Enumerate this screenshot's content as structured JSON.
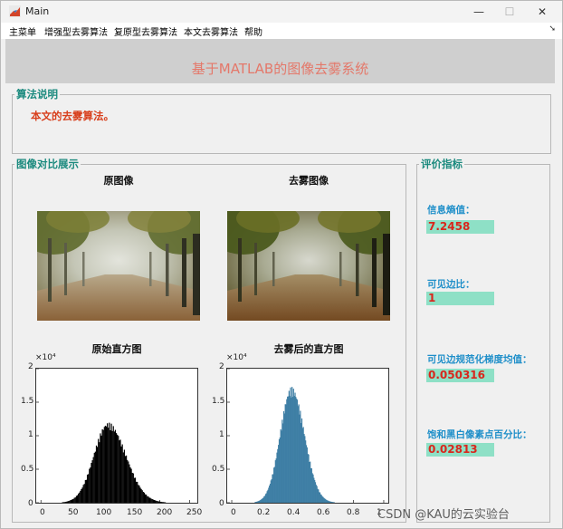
{
  "window": {
    "title": "Main",
    "minimize_glyph": "—",
    "maximize_glyph": "☐",
    "close_glyph": "✕"
  },
  "menu": {
    "items": [
      "主菜单",
      "增强型去雾算法",
      "复原型去雾算法",
      "本文去雾算法",
      "帮助"
    ],
    "overflow_arrow": "➘"
  },
  "banner": {
    "title": "基于MATLAB的图像去雾系统"
  },
  "algorithm_panel": {
    "title": "算法说明",
    "text": "本文的去雾算法。"
  },
  "comparison_panel": {
    "title": "图像对比展示",
    "original_caption": "原图像",
    "dehazed_caption": "去雾图像",
    "original_hist_caption": "原始直方图",
    "dehazed_hist_caption": "去雾后的直方图"
  },
  "metrics_panel": {
    "title": "评价指标",
    "items": [
      {
        "label": "信息熵值：",
        "value": "7.2458"
      },
      {
        "label": "可见边比：",
        "value": "1"
      },
      {
        "label": "可见边规范化梯度均值：",
        "value": "0.050316"
      },
      {
        "label": "饱和黑白像素点百分比：",
        "value": "0.02813"
      }
    ]
  },
  "chart_data": [
    {
      "type": "bar",
      "title": "原始直方图",
      "exponent_label": "×10⁴",
      "ylim": [
        0,
        20000
      ],
      "y_ticks": [
        "0",
        "0.5",
        "1",
        "1.5",
        "2"
      ],
      "x_ticks": [
        "0",
        "50",
        "100",
        "150",
        "200",
        "250"
      ],
      "xlim": [
        -8,
        263
      ],
      "color": "#000000",
      "x_peak": 112,
      "peak_value": 12000,
      "spread_left": 24,
      "spread_right": 30
    },
    {
      "type": "bar",
      "title": "去雾后的直方图",
      "exponent_label": "×10⁴",
      "ylim": [
        0,
        20000
      ],
      "y_ticks": [
        "0",
        "0.5",
        "1",
        "1.5",
        "2"
      ],
      "x_ticks": [
        "0",
        "0.2",
        "0.4",
        "0.6",
        "0.8",
        "1"
      ],
      "xlim": [
        -0.03,
        1.03
      ],
      "color": "#3f7fa5",
      "x_peak": 0.39,
      "peak_value": 17300,
      "spread_left": 0.075,
      "spread_right": 0.085
    }
  ],
  "watermark": "CSDN @KAU的云实验台"
}
